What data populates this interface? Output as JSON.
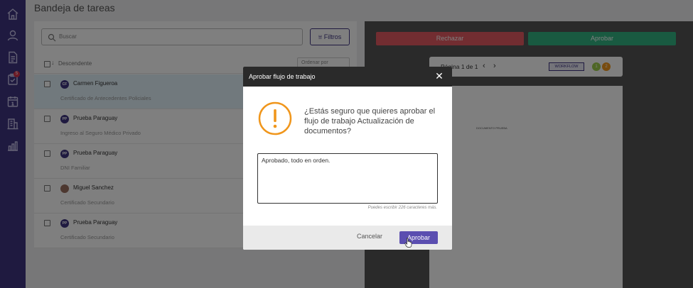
{
  "header": {
    "title": "Bandeja de tareas"
  },
  "sidebar": {
    "items": [
      {
        "icon": "home-icon"
      },
      {
        "icon": "user-icon"
      },
      {
        "icon": "document-icon"
      },
      {
        "icon": "tasks-icon",
        "badge": "5"
      },
      {
        "icon": "calendar-icon"
      },
      {
        "icon": "building-icon"
      },
      {
        "icon": "chart-icon"
      }
    ]
  },
  "search": {
    "placeholder": "Buscar"
  },
  "filters": {
    "label": "Filtros"
  },
  "list": {
    "sort_label": "Descendente",
    "order_placeholder": "Ordenar por",
    "rows": [
      {
        "initials": "CF",
        "name": "Carmen Figueroa",
        "subtitle": "Certificado de Antecedentes Policiales",
        "selected": true
      },
      {
        "initials": "PP",
        "name": "Prueba Paraguay",
        "subtitle": "Ingreso al Seguro Médico Privado",
        "selected": false
      },
      {
        "initials": "PP",
        "name": "Prueba Paraguay",
        "subtitle": "DNI Familiar",
        "selected": false
      },
      {
        "initials": "",
        "name": "Miguel Sanchez",
        "subtitle": "Certificado Secundario",
        "selected": false
      },
      {
        "initials": "PP",
        "name": "Prueba Paraguay",
        "subtitle": "Certificado Secundario",
        "selected": false
      }
    ]
  },
  "viewer": {
    "reject_label": "Rechazar",
    "approve_label": "Aprobar",
    "page_indicator": "Página 1 de 1",
    "workflow_badge": "WORKFLOW",
    "step1": "1",
    "step2": "2",
    "doc_title": "DOCUMENTO PRUEBA"
  },
  "modal": {
    "title": "Aprobar flujo de trabajo",
    "question": "¿Estás seguro que quieres aprobar el flujo de trabajo Actualización de documentos?",
    "comment_value": "Aprobado, todo en orden.",
    "hint": "Puedes escribir 226 caracteres más.",
    "cancel_label": "Cancelar",
    "approve_label": "Aprobar"
  },
  "colors": {
    "sidebar": "#3e3480",
    "reject": "#e55b62",
    "approve_green": "#33b583",
    "primary": "#5b4eb0",
    "warning": "#f0961c"
  }
}
